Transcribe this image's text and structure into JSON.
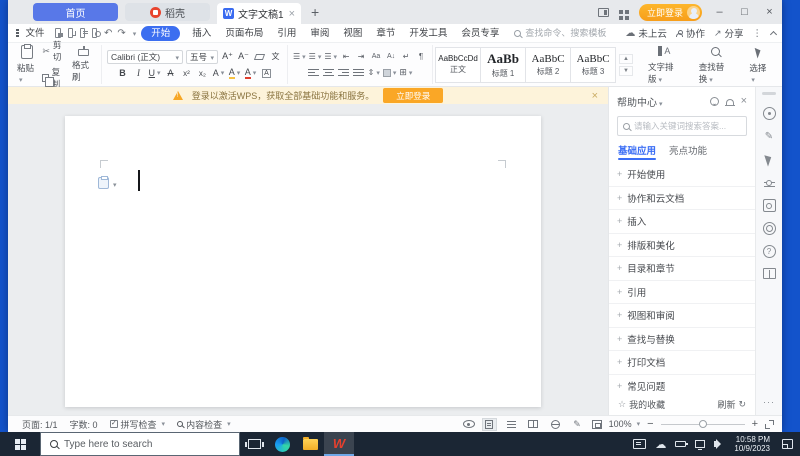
{
  "colors": {
    "accent_blue": "#3c6ef0",
    "tab_blue": "#5878e8",
    "orange": "#f9a528",
    "desktop_blue": "#1353cb",
    "notice_bg": "#fdf3da",
    "taskbar_bg": "#1b2634"
  },
  "titlebar": {
    "home_tab": "首页",
    "docer_tab": "稻壳",
    "doc_tab": "文字文稿1",
    "login": "立即登录"
  },
  "menubar": {
    "file": "文件",
    "tabs": [
      {
        "label": "开始"
      },
      {
        "label": "插入"
      },
      {
        "label": "页面布局"
      },
      {
        "label": "引用"
      },
      {
        "label": "审阅"
      },
      {
        "label": "视图"
      },
      {
        "label": "章节"
      },
      {
        "label": "开发工具"
      },
      {
        "label": "会员专享"
      }
    ],
    "search_placeholder": "查找命令、搜索模板",
    "cloud": "未上云",
    "collab": "协作",
    "share": "分享"
  },
  "ribbon": {
    "paste": "粘贴",
    "cut": "剪切",
    "copy": "复制",
    "format_painter": "格式刷",
    "font_name": "Calibri (正文)",
    "font_size": "五号",
    "styles": [
      {
        "sample": "AaBbCcDd",
        "label": "正文"
      },
      {
        "sample": "AaBb",
        "label": "标题 1"
      },
      {
        "sample": "AaBbC",
        "label": "标题 2"
      },
      {
        "sample": "AaBbC",
        "label": "标题 3"
      }
    ],
    "text_layout": "文字排版",
    "find_replace": "查找替换",
    "select": "选择"
  },
  "notice": {
    "message": "登录以激活WPS，获取全部基础功能和服务。",
    "action": "立即登录"
  },
  "help": {
    "title": "帮助中心",
    "search_placeholder": "请输入关键词搜索答案...",
    "tabs": [
      {
        "label": "基础应用"
      },
      {
        "label": "亮点功能"
      }
    ],
    "items": [
      {
        "label": "开始使用"
      },
      {
        "label": "协作和云文档"
      },
      {
        "label": "插入"
      },
      {
        "label": "排版和美化"
      },
      {
        "label": "目录和章节"
      },
      {
        "label": "引用"
      },
      {
        "label": "视图和审阅"
      },
      {
        "label": "查找与替换"
      },
      {
        "label": "打印文档"
      },
      {
        "label": "常见问题"
      }
    ],
    "favorites": "我的收藏",
    "refresh": "刷新"
  },
  "statusbar": {
    "page": "页面: 1/1",
    "words": "字数: 0",
    "spellcheck": "拼写检查",
    "content_check": "内容检查",
    "zoom_level": "100%"
  },
  "taskbar": {
    "search_placeholder": "Type here to search",
    "time": "10:58 PM",
    "date": "10/9/2023"
  }
}
